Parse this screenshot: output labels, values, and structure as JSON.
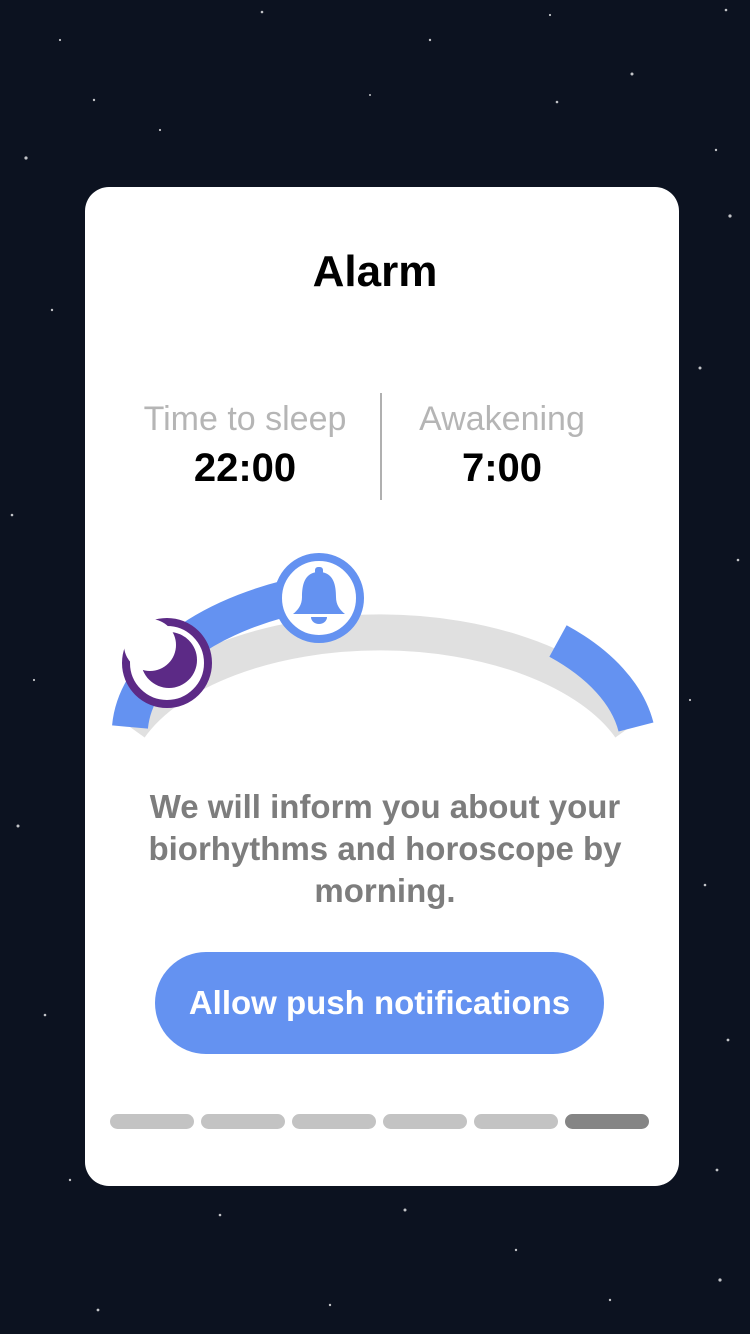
{
  "card": {
    "title": "Alarm"
  },
  "schedule": {
    "sleep_label": "Time to sleep",
    "sleep_time": "22:00",
    "wake_label": "Awakening",
    "wake_time": "7:00"
  },
  "gauge": {
    "active_color": "#6492f1",
    "inactive_color": "#e0e0e0",
    "sleep_marker_icon": "moon-icon",
    "sleep_marker_color": "#5c2a86",
    "wake_marker_icon": "bell-icon",
    "wake_marker_color": "#6492f1"
  },
  "message": "We will inform you about your biorhythms and horoscope by morning.",
  "actions": {
    "allow_label": "Allow push notifications"
  },
  "pager": {
    "total": 6,
    "current": 6,
    "active_color": "#858585",
    "inactive_color": "#c3c3c3"
  },
  "colors": {
    "background": "#0c1220",
    "card": "#ffffff",
    "accent": "#6492f1"
  }
}
